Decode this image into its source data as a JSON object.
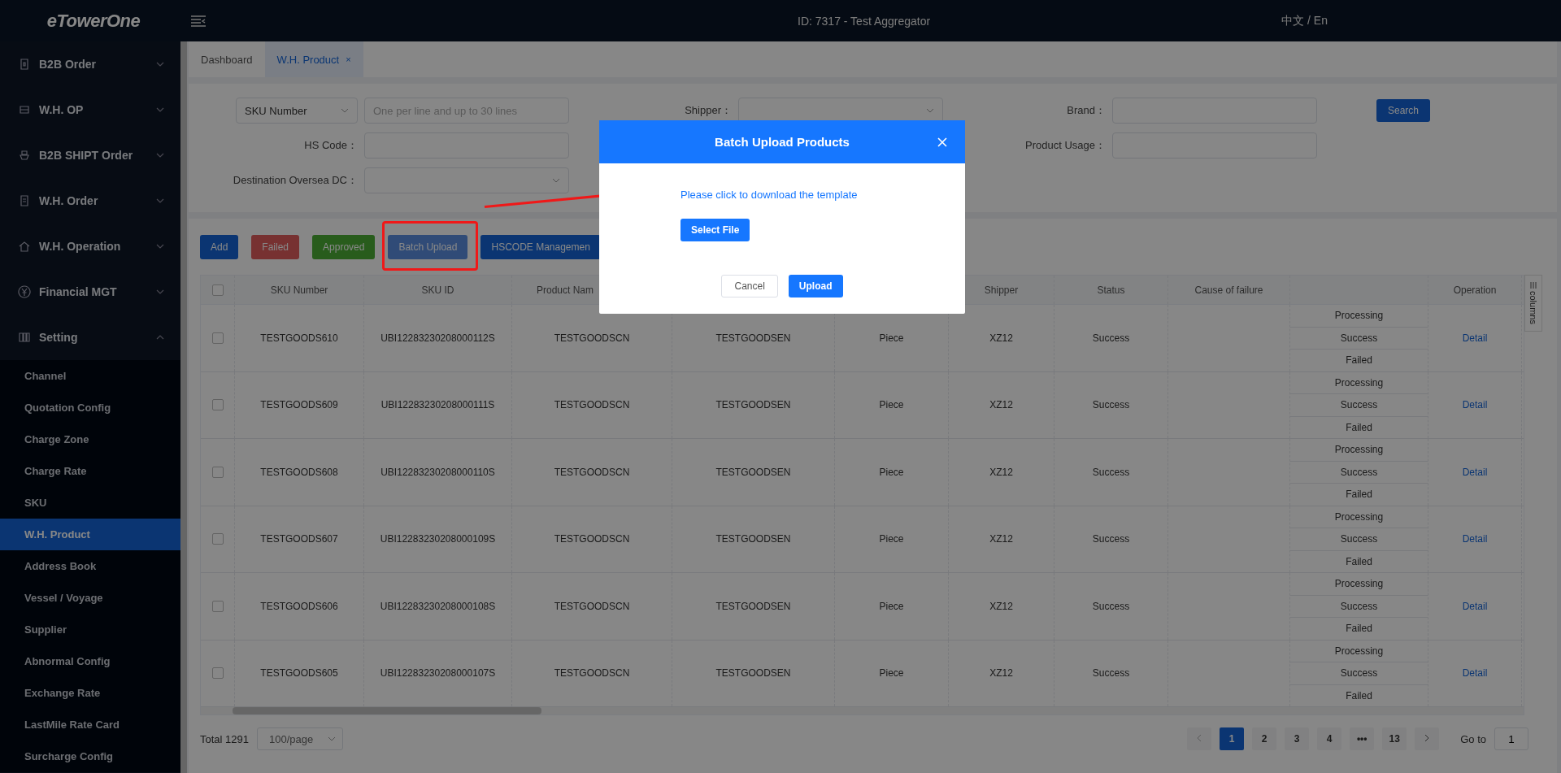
{
  "app": {
    "logo": "eTowerOne",
    "title": "ID: 7317 - Test Aggregator",
    "language": "中文 / En"
  },
  "sidebar": {
    "items": [
      {
        "label": "B2B Order",
        "expanded": false
      },
      {
        "label": "W.H. OP",
        "expanded": false
      },
      {
        "label": "B2B SHIPT Order",
        "expanded": false
      },
      {
        "label": "W.H. Order",
        "expanded": false
      },
      {
        "label": "W.H. Operation",
        "expanded": false
      },
      {
        "label": "Financial MGT",
        "expanded": false
      },
      {
        "label": "Setting",
        "expanded": true,
        "children": [
          {
            "label": "Channel",
            "selected": false
          },
          {
            "label": "Quotation Config",
            "selected": false
          },
          {
            "label": "Charge Zone",
            "selected": false
          },
          {
            "label": "Charge Rate",
            "selected": false
          },
          {
            "label": "SKU",
            "selected": false
          },
          {
            "label": "W.H. Product",
            "selected": true
          },
          {
            "label": "Address Book",
            "selected": false
          },
          {
            "label": "Vessel / Voyage",
            "selected": false
          },
          {
            "label": "Supplier",
            "selected": false
          },
          {
            "label": "Abnormal Config",
            "selected": false
          },
          {
            "label": "Exchange Rate",
            "selected": false
          },
          {
            "label": "LastMile Rate Card",
            "selected": false
          },
          {
            "label": "Surcharge Config",
            "selected": false
          }
        ]
      }
    ]
  },
  "tabs": [
    {
      "label": "Dashboard",
      "selected": false
    },
    {
      "label": "W.H. Product",
      "selected": true,
      "close": "×"
    }
  ],
  "filters": {
    "sku_type": "SKU Number",
    "sku_input": {
      "placeholder": "One per line and up to 30 lines"
    },
    "shipper": "Shipper：",
    "brand": "Brand：",
    "search": "Search",
    "hs_code": "HS Code：",
    "product_usage": "Product Usage：",
    "destination": "Destination Oversea DC："
  },
  "toolbar": [
    {
      "label": "Add",
      "kind": "primary"
    },
    {
      "label": "Failed",
      "kind": "danger"
    },
    {
      "label": "Approved",
      "kind": "success"
    },
    {
      "label": "Batch Upload",
      "kind": "info"
    },
    {
      "label": "HSCODE Managemen",
      "kind": "primary"
    }
  ],
  "table": {
    "header_checked": false,
    "header": {
      "sku_number": "SKU Number",
      "sku_id": "SKU ID",
      "product_name": "Product Nam",
      "shipper": "Shipper",
      "status": "Status",
      "cause_of_failure": "Cause of failure",
      "operation": "Operation"
    },
    "rows": [
      {
        "checked": false,
        "sku_number": "TESTGOODS610",
        "sku_id": "UBI12283230208000112S",
        "product_name": "TESTGOODSCN",
        "column_4": "TESTGOODSEN",
        "column_5": "Piece",
        "shipper": "XZ12",
        "status": "Success",
        "states": [
          "Processing",
          "Success",
          "Failed"
        ],
        "operation": "Detail"
      },
      {
        "checked": false,
        "sku_number": "TESTGOODS609",
        "sku_id": "UBI12283230208000111S",
        "product_name": "TESTGOODSCN",
        "column_4": "TESTGOODSEN",
        "column_5": "Piece",
        "shipper": "XZ12",
        "status": "Success",
        "states": [
          "Processing",
          "Success",
          "Failed"
        ],
        "operation": "Detail"
      },
      {
        "checked": false,
        "sku_number": "TESTGOODS608",
        "sku_id": "UBI12283230208000110S",
        "product_name": "TESTGOODSCN",
        "column_4": "TESTGOODSEN",
        "column_5": "Piece",
        "shipper": "XZ12",
        "status": "Success",
        "states": [
          "Processing",
          "Success",
          "Failed"
        ],
        "operation": "Detail"
      },
      {
        "checked": false,
        "sku_number": "TESTGOODS607",
        "sku_id": "UBI12283230208000109S",
        "product_name": "TESTGOODSCN",
        "column_4": "TESTGOODSEN",
        "column_5": "Piece",
        "shipper": "XZ12",
        "status": "Success",
        "states": [
          "Processing",
          "Success",
          "Failed"
        ],
        "operation": "Detail"
      },
      {
        "checked": false,
        "sku_number": "TESTGOODS606",
        "sku_id": "UBI12283230208000108S",
        "product_name": "TESTGOODSCN",
        "column_4": "TESTGOODSEN",
        "column_5": "Piece",
        "shipper": "XZ12",
        "status": "Success",
        "states": [
          "Processing",
          "Success",
          "Failed"
        ],
        "operation": "Detail"
      },
      {
        "checked": false,
        "sku_number": "TESTGOODS605",
        "sku_id": "UBI12283230208000107S",
        "product_name": "TESTGOODSCN",
        "column_4": "TESTGOODSEN",
        "column_5": "Piece",
        "shipper": "XZ12",
        "status": "Success",
        "states": [
          "Processing",
          "Success",
          "Failed"
        ],
        "operation": "Detail"
      }
    ],
    "columns_tab": "columns"
  },
  "pagination": {
    "total": "Total 1291",
    "page_size": "100/page",
    "pages": [
      {
        "label": "1",
        "selected": true
      },
      {
        "label": "2",
        "selected": false
      },
      {
        "label": "3",
        "selected": false
      },
      {
        "label": "4",
        "selected": false
      },
      {
        "label": "•••",
        "selected": false
      },
      {
        "label": "13",
        "selected": false
      }
    ],
    "goto_label": "Go to",
    "goto_value": "1"
  },
  "modal": {
    "title": "Batch Upload Products",
    "link": "Please click to download the template",
    "select_file": "Select File",
    "cancel": "Cancel",
    "upload": "Upload"
  }
}
